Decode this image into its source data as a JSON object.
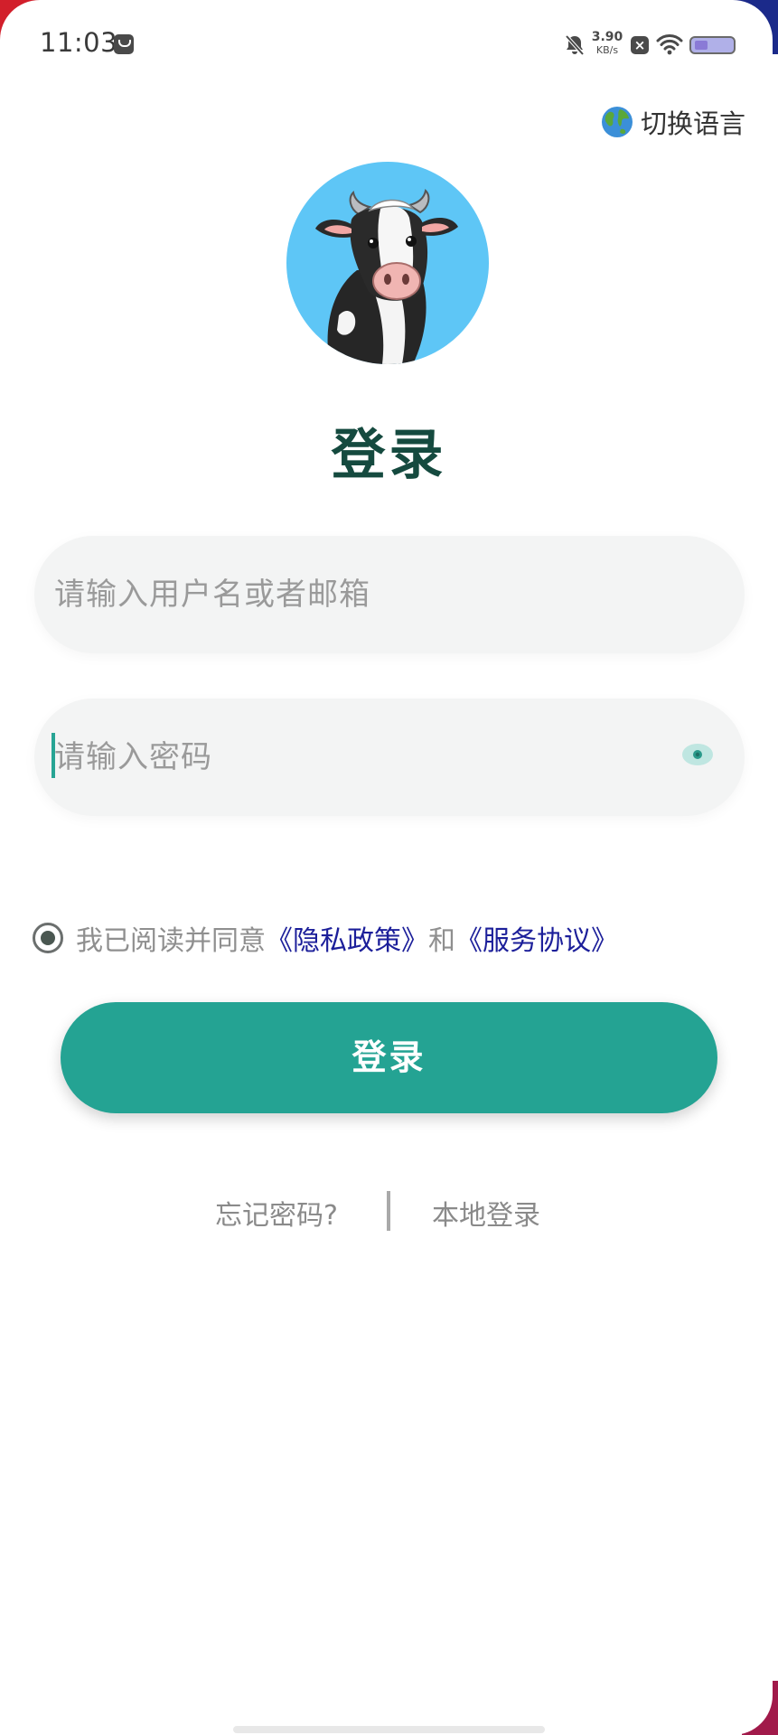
{
  "status_bar": {
    "time": "11:03",
    "net_speed_value": "3.90",
    "net_speed_unit": "KB/s"
  },
  "language_switch": {
    "label": "切换语言",
    "icon": "globe-icon"
  },
  "avatar": {
    "icon": "cow-icon",
    "background_color": "#5ec6f6"
  },
  "title": "登录",
  "username_field": {
    "placeholder": "请输入用户名或者邮箱"
  },
  "password_field": {
    "placeholder": "请输入密码",
    "toggle_icon": "eye-icon"
  },
  "agreement": {
    "prefix": "我已阅读并同意",
    "privacy_link": "《隐私政策》",
    "joiner": "和",
    "service_link": "《服务协议》",
    "checked": true
  },
  "login_button": {
    "label": "登录"
  },
  "bottom_links": {
    "forgot_password": "忘记密码?",
    "local_login": "本地登录"
  },
  "colors": {
    "accent": "#24a393",
    "title": "#154a3f",
    "link": "#1c1f9a"
  }
}
